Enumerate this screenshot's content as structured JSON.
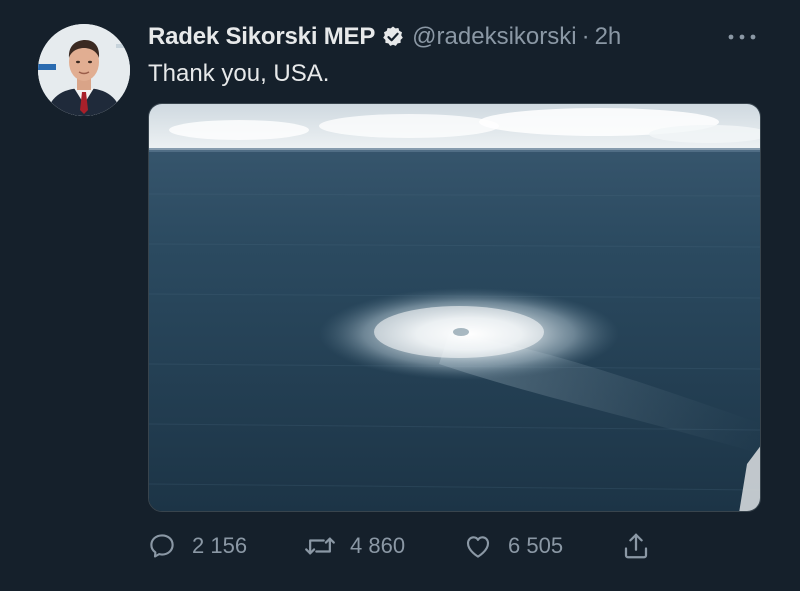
{
  "tweet": {
    "author": {
      "display_name": "Radek Sikorski MEP",
      "verified": true,
      "handle": "@radeksikorski",
      "separator": "·",
      "time": "2h"
    },
    "text": "Thank you, USA.",
    "media": {
      "icon": "photo-icon"
    },
    "actions": {
      "reply": {
        "icon": "reply-icon",
        "count": "2 156"
      },
      "retweet": {
        "icon": "retweet-icon",
        "count": "4 860"
      },
      "like": {
        "icon": "heart-icon",
        "count": "6 505"
      },
      "share": {
        "icon": "share-icon"
      }
    }
  },
  "colors": {
    "background": "#15202b",
    "primary_text": "#e7e9ea",
    "secondary_text": "#8b98a5",
    "verified_badge": "#e7e9ea"
  }
}
